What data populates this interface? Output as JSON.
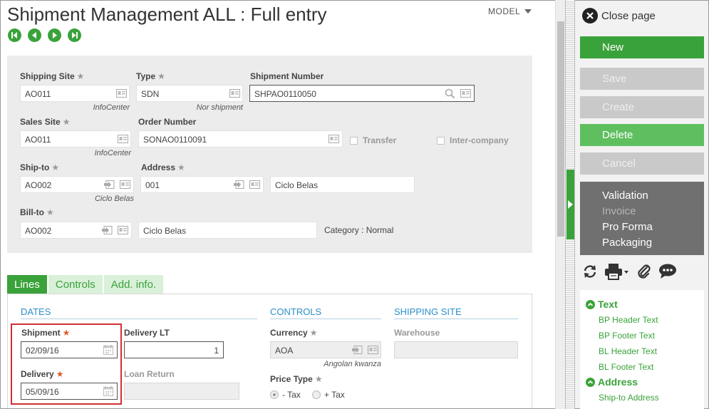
{
  "header": {
    "title": "Shipment Management ALL : Full entry",
    "model_label": "MODEL"
  },
  "form": {
    "shipping_site": {
      "label": "Shipping Site",
      "value": "AO011",
      "desc": "InfoCenter"
    },
    "type": {
      "label": "Type",
      "value": "SDN",
      "desc": "Nor shipment"
    },
    "shipment_number": {
      "label": "Shipment Number",
      "value": "SHPAO0110050"
    },
    "sales_site": {
      "label": "Sales Site",
      "value": "AO011",
      "desc": "InfoCenter"
    },
    "order_number": {
      "label": "Order Number",
      "value": "SONAO0110091"
    },
    "transfer": {
      "label": "Transfer"
    },
    "inter_company": {
      "label": "Inter-company"
    },
    "ship_to": {
      "label": "Ship-to",
      "value": "AO002",
      "desc": "Ciclo Belas"
    },
    "address": {
      "label": "Address",
      "value": "001",
      "name": "Ciclo Belas"
    },
    "bill_to": {
      "label": "Bill-to",
      "value": "AO002",
      "name": "Ciclo Belas"
    },
    "category": "Category : Normal"
  },
  "tabs": [
    {
      "label": "Lines"
    },
    {
      "label": "Controls"
    },
    {
      "label": "Add. info."
    }
  ],
  "lines": {
    "dates_title": "DATES",
    "controls_title": "CONTROLS",
    "shipping_site_title": "SHIPPING SITE",
    "shipment": {
      "label": "Shipment",
      "value": "02/09/16"
    },
    "delivery_lt": {
      "label": "Delivery LT",
      "value": "1"
    },
    "delivery": {
      "label": "Delivery",
      "value": "05/09/16"
    },
    "loan_return": {
      "label": "Loan Return",
      "value": ""
    },
    "currency": {
      "label": "Currency",
      "value": "AOA",
      "desc": "Angolan kwanza"
    },
    "price_type": {
      "label": "Price Type",
      "minus_tax": "- Tax",
      "plus_tax": "+ Tax"
    },
    "warehouse": {
      "label": "Warehouse",
      "value": ""
    }
  },
  "right_panel": {
    "close_label": "Close page",
    "buttons": {
      "new": "New",
      "save": "Save",
      "create": "Create",
      "delete": "Delete",
      "cancel": "Cancel"
    },
    "menu": {
      "validation": "Validation",
      "invoice": "Invoice",
      "pro_forma": "Pro Forma",
      "packaging": "Packaging"
    },
    "links": {
      "text_heading": "Text",
      "bp_header_text": "BP Header Text",
      "bp_footer_text": "BP Footer Text",
      "bl_header_text": "BL Header Text",
      "bl_footer_text": "BL Footer Text",
      "address_heading": "Address",
      "ship_to_address": "Ship-to Address"
    }
  },
  "colors": {
    "accent_green": "#3aa23a",
    "section_blue": "#2c8fc9",
    "highlight_red": "#d32f2f"
  }
}
